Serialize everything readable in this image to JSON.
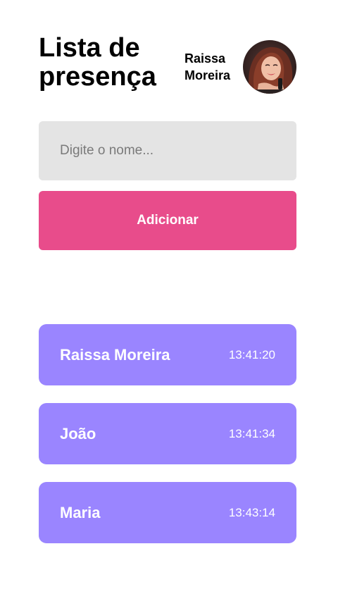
{
  "header": {
    "title": "Lista de presença",
    "user_name": "Raissa Moreira"
  },
  "form": {
    "input_placeholder": "Digite o nome...",
    "input_value": "",
    "add_label": "Adicionar"
  },
  "attendees": [
    {
      "name": "Raissa Moreira",
      "time": "13:41:20"
    },
    {
      "name": "João",
      "time": "13:41:34"
    },
    {
      "name": "Maria",
      "time": "13:43:14"
    }
  ],
  "colors": {
    "accent": "#e84c8b",
    "card": "#9a85ff",
    "input_bg": "#e4e4e4"
  }
}
